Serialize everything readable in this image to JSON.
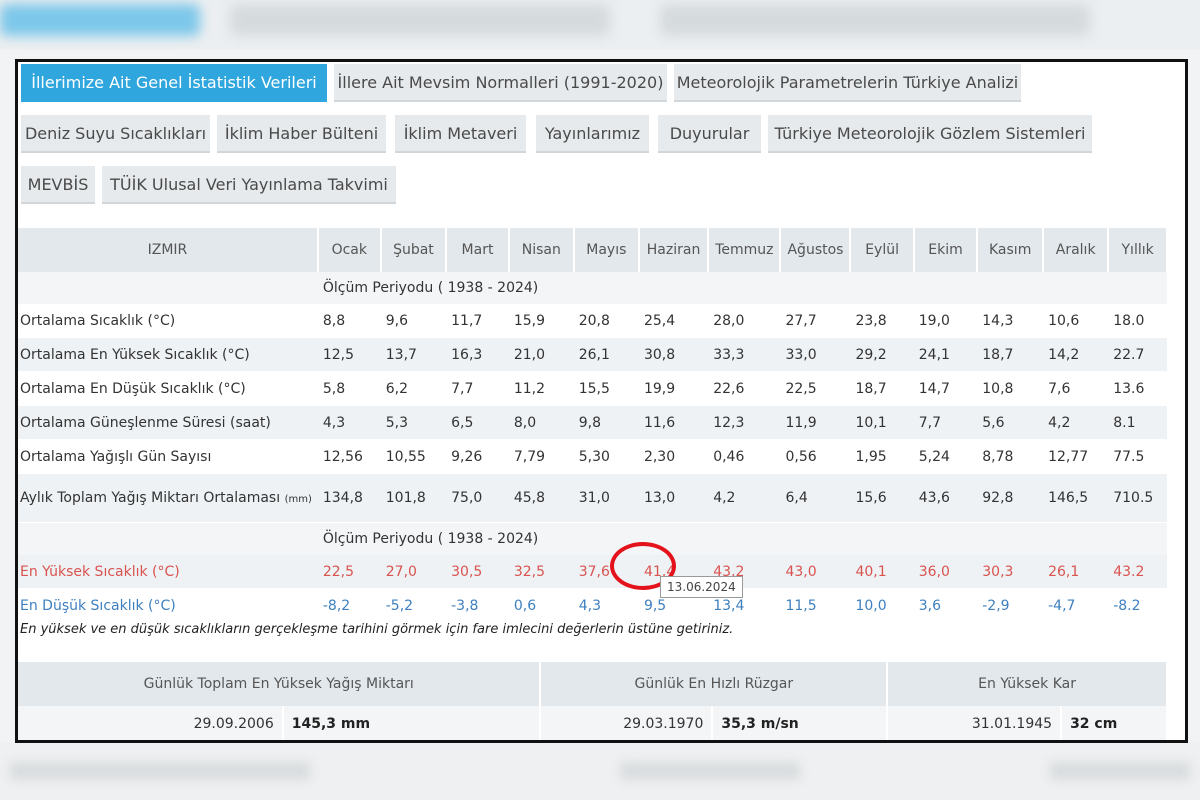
{
  "tabs": [
    "İllerimize Ait Genel İstatistik Verileri",
    "İllere Ait Mevsim Normalleri (1991-2020)",
    "Meteorolojik Parametrelerin Türkiye Analizi",
    "Deniz Suyu Sıcaklıkları",
    "İklim Haber Bülteni",
    "İklim Metaveri",
    "Yayınlarımız",
    "Duyurular",
    "Türkiye Meteorolojik Gözlem Sistemleri",
    "MEVBİS",
    "TÜİK Ulusal Veri Yayınlama Takvimi"
  ],
  "table": {
    "city": "IZMIR",
    "months": [
      "Ocak",
      "Şubat",
      "Mart",
      "Nisan",
      "Mayıs",
      "Haziran",
      "Temmuz",
      "Ağustos",
      "Eylül",
      "Ekim",
      "Kasım",
      "Aralık",
      "Yıllık"
    ],
    "period": "Ölçüm Periyodu ( 1938 - 2024)",
    "rows": [
      {
        "label": "Ortalama Sıcaklık (°C)",
        "values": [
          "8,8",
          "9,6",
          "11,7",
          "15,9",
          "20,8",
          "25,4",
          "28,0",
          "27,7",
          "23,8",
          "19,0",
          "14,3",
          "10,6",
          "18.0"
        ]
      },
      {
        "label": "Ortalama En Yüksek Sıcaklık (°C)",
        "values": [
          "12,5",
          "13,7",
          "16,3",
          "21,0",
          "26,1",
          "30,8",
          "33,3",
          "33,0",
          "29,2",
          "24,1",
          "18,7",
          "14,2",
          "22.7"
        ]
      },
      {
        "label": "Ortalama En Düşük Sıcaklık (°C)",
        "values": [
          "5,8",
          "6,2",
          "7,7",
          "11,2",
          "15,5",
          "19,9",
          "22,6",
          "22,5",
          "18,7",
          "14,7",
          "10,8",
          "7,6",
          "13.6"
        ]
      },
      {
        "label": "Ortalama Güneşlenme Süresi (saat)",
        "values": [
          "4,3",
          "5,3",
          "6,5",
          "8,0",
          "9,8",
          "11,6",
          "12,3",
          "11,9",
          "10,1",
          "7,7",
          "5,6",
          "4,2",
          "8.1"
        ]
      },
      {
        "label": "Ortalama Yağışlı Gün Sayısı",
        "values": [
          "12,56",
          "10,55",
          "9,26",
          "7,79",
          "5,30",
          "2,30",
          "0,46",
          "0,56",
          "1,95",
          "5,24",
          "8,78",
          "12,77",
          "77.5"
        ]
      },
      {
        "label": "Aylık Toplam Yağış Miktarı Ortalaması",
        "unit": "(mm)",
        "values": [
          "134,8",
          "101,8",
          "75,0",
          "45,8",
          "31,0",
          "13,0",
          "4,2",
          "6,4",
          "15,6",
          "43,6",
          "92,8",
          "146,5",
          "710.5"
        ]
      }
    ],
    "period2": "Ölçüm Periyodu ( 1938 - 2024)",
    "max_row": {
      "label": "En Yüksek Sıcaklık (°C)",
      "values": [
        "22,5",
        "27,0",
        "30,5",
        "32,5",
        "37,6",
        "41,4",
        "43,2",
        "43,0",
        "40,1",
        "36,0",
        "30,3",
        "26,1",
        "43.2"
      ]
    },
    "min_row": {
      "label": "En Düşük Sıcaklık (°C)",
      "values": [
        "-8,2",
        "-5,2",
        "-3,8",
        "0,6",
        "4,3",
        "9,5",
        "13,4",
        "11,5",
        "10,0",
        "3,6",
        "-2,9",
        "-4,7",
        "-8.2"
      ]
    },
    "tooltip": "13.06.2024",
    "note": "En yüksek ve en düşük sıcaklıkların gerçekleşme tarihini görmek için fare imlecini değerlerin üstüne getiriniz."
  },
  "extremes": [
    {
      "title": "Günlük Toplam En Yüksek Yağış Miktarı",
      "date": "29.09.2006",
      "value": "145,3 mm"
    },
    {
      "title": "Günlük En Hızlı Rüzgar",
      "date": "29.03.1970",
      "value": "35,3 m/sn"
    },
    {
      "title": "En Yüksek Kar",
      "date": "31.01.1945",
      "value": "32 cm"
    }
  ],
  "colors": {
    "active_tab": "#2fa6dd",
    "max_temp": "#d9534f",
    "min_temp": "#3e7fbf",
    "highlight_circle": "#e3121b"
  }
}
